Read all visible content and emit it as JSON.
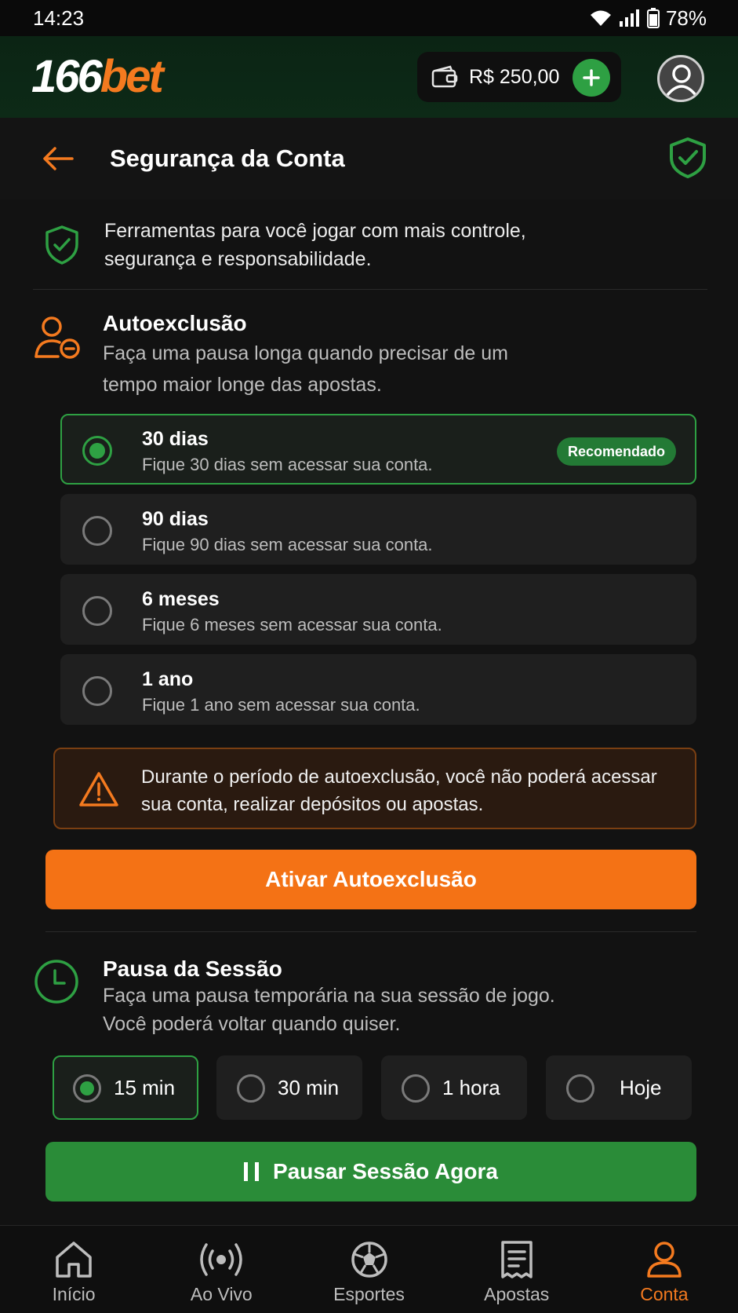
{
  "status_bar": {
    "time": "14:23",
    "battery": "78%"
  },
  "header": {
    "logo_num": "166",
    "logo_bet": "bet",
    "balance": "R$ 250,00"
  },
  "title_bar": {
    "title": "Segurança da Conta"
  },
  "intro": {
    "text": "Ferramentas para você jogar com mais controle, segurança e responsabilidade."
  },
  "autoexclusao": {
    "title": "Autoexclusão",
    "description": "Faça uma pausa longa quando precisar de um tempo maior longe das apostas.",
    "options": [
      {
        "title": "30 dias",
        "subtitle": "Fique 30 dias sem acessar sua conta.",
        "badge": "Recomendado",
        "selected": true
      },
      {
        "title": "90 dias",
        "subtitle": "Fique 90 dias sem acessar sua conta.",
        "selected": false
      },
      {
        "title": "6 meses",
        "subtitle": "Fique 6 meses sem acessar sua conta.",
        "selected": false
      },
      {
        "title": "1 ano",
        "subtitle": "Fique 1 ano sem acessar sua conta.",
        "selected": false
      }
    ],
    "warning": "Durante o período de autoexclusão, você não poderá acessar sua conta, realizar depósitos ou apostas.",
    "button": "Ativar Autoexclusão"
  },
  "pausa": {
    "title": "Pausa da Sessão",
    "description_line1": "Faça uma pausa temporária na sua sessão de jogo.",
    "description_line2": "Você poderá voltar quando quiser.",
    "options": [
      {
        "label": "15 min",
        "selected": true
      },
      {
        "label": "30 min",
        "selected": false
      },
      {
        "label": "1 hora",
        "selected": false
      },
      {
        "label": "Hoje",
        "selected": false
      }
    ],
    "button": "Pausar Sessão Agora"
  },
  "bottom_nav": [
    {
      "label": "Início",
      "icon": "home-icon",
      "active": false
    },
    {
      "label": "Ao Vivo",
      "icon": "live-icon",
      "active": false
    },
    {
      "label": "Esportes",
      "icon": "soccer-ball-icon",
      "active": false
    },
    {
      "label": "Apostas",
      "icon": "bet-slip-icon",
      "active": false
    },
    {
      "label": "Conta",
      "icon": "user-icon",
      "active": true
    }
  ],
  "colors": {
    "accent_orange": "#f47215",
    "accent_green": "#2ea043",
    "background": "#121212"
  }
}
